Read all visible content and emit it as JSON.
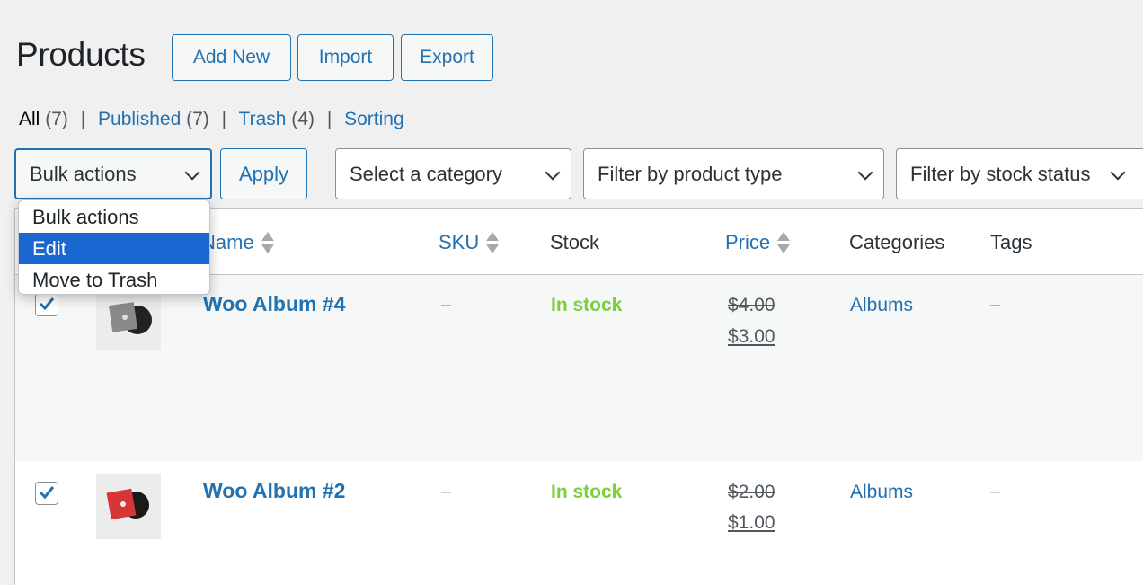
{
  "header": {
    "title": "Products",
    "buttons": [
      "Add New",
      "Import",
      "Export"
    ]
  },
  "views": [
    {
      "label": "All",
      "count": "(7)",
      "current": true
    },
    {
      "label": "Published",
      "count": "(7)",
      "current": false
    },
    {
      "label": "Trash",
      "count": "(4)",
      "current": false
    },
    {
      "label": "Sorting",
      "count": "",
      "current": false
    }
  ],
  "separator": "|",
  "filters": {
    "bulk_actions": "Bulk actions",
    "apply": "Apply",
    "category": "Select a category",
    "product_type": "Filter by product type",
    "stock_status": "Filter by stock status"
  },
  "bulk_dropdown": {
    "options": [
      "Bulk actions",
      "Edit",
      "Move to Trash"
    ],
    "highlighted": "Edit"
  },
  "table": {
    "columns": [
      "Name",
      "SKU",
      "Stock",
      "Price",
      "Categories",
      "Tags"
    ],
    "rows": [
      {
        "checked": true,
        "thumb": "album-black-white",
        "name": "Woo Album #4",
        "sku": "–",
        "stock": "In stock",
        "regular_price": "$4.00",
        "sale_price": "$3.00",
        "categories": "Albums",
        "tags": "–"
      },
      {
        "checked": true,
        "thumb": "album-red",
        "name": "Woo Album #2",
        "sku": "–",
        "stock": "In stock",
        "regular_price": "$2.00",
        "sale_price": "$1.00",
        "categories": "Albums",
        "tags": "–"
      }
    ]
  },
  "colors": {
    "accent": "#2271b1",
    "in_stock": "#7ad03a",
    "highlight": "#1a67d2"
  }
}
